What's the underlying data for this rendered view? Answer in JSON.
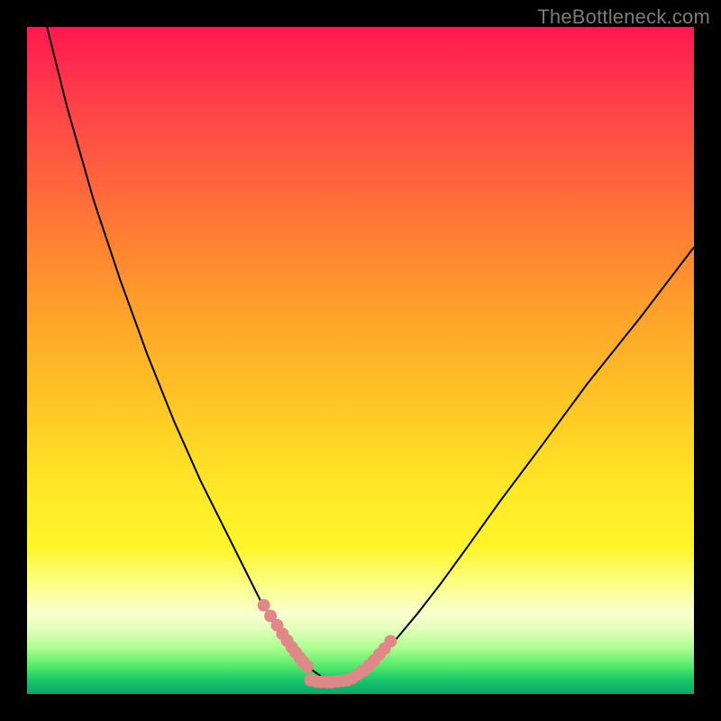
{
  "watermark": "TheBottleneck.com",
  "colors": {
    "curve": "#000000",
    "marker": "#e08888",
    "marker_stroke": "#c46a6a"
  },
  "chart_data": {
    "type": "line",
    "title": "",
    "xlabel": "",
    "ylabel": "",
    "xlim": [
      0,
      100
    ],
    "ylim": [
      0,
      100
    ],
    "grid": false,
    "series": [
      {
        "name": "left-curve",
        "x": [
          3,
          6,
          10,
          14,
          18,
          22,
          26,
          30,
          33,
          35,
          37,
          38.5,
          40,
          41,
          42,
          43,
          44,
          45,
          46
        ],
        "y": [
          100,
          88,
          74,
          62,
          51,
          41,
          32,
          24,
          18,
          14,
          11,
          9,
          7,
          5.5,
          4.3,
          3.4,
          2.7,
          2.2,
          1.8
        ]
      },
      {
        "name": "right-curve",
        "x": [
          46,
          47,
          48,
          49,
          50,
          51,
          52.5,
          54,
          56,
          58.5,
          62,
          66,
          71,
          77,
          84,
          92,
          100
        ],
        "y": [
          1.8,
          1.8,
          2.0,
          2.4,
          3.0,
          3.8,
          5.0,
          6.6,
          9.0,
          12.0,
          16.5,
          22.0,
          29.0,
          37.0,
          46.5,
          56.5,
          67.0
        ]
      },
      {
        "name": "left-markers",
        "x": [
          35.5,
          36.5,
          37.5,
          38.3,
          39.0,
          39.7,
          40.3,
          40.9,
          41.4,
          42.0
        ],
        "y": [
          13.3,
          11.7,
          10.3,
          9.0,
          8.0,
          7.0,
          6.2,
          5.4,
          4.8,
          4.1
        ]
      },
      {
        "name": "right-markers",
        "x": [
          48.0,
          48.8,
          49.6,
          50.4,
          51.2,
          52.0,
          52.8,
          53.6,
          54.5
        ],
        "y": [
          2.1,
          2.4,
          2.9,
          3.5,
          4.2,
          5.0,
          5.9,
          6.8,
          7.9
        ]
      },
      {
        "name": "bottom-markers",
        "x": [
          42.5,
          43.3,
          44.1,
          44.9,
          45.7,
          46.5,
          47.3
        ],
        "y": [
          2.1,
          1.9,
          1.8,
          1.8,
          1.8,
          1.9,
          2.0
        ]
      }
    ],
    "notes": "Axes are unlabeled in the source image; values are pixel-normalized estimates on a 0..100 scale."
  }
}
